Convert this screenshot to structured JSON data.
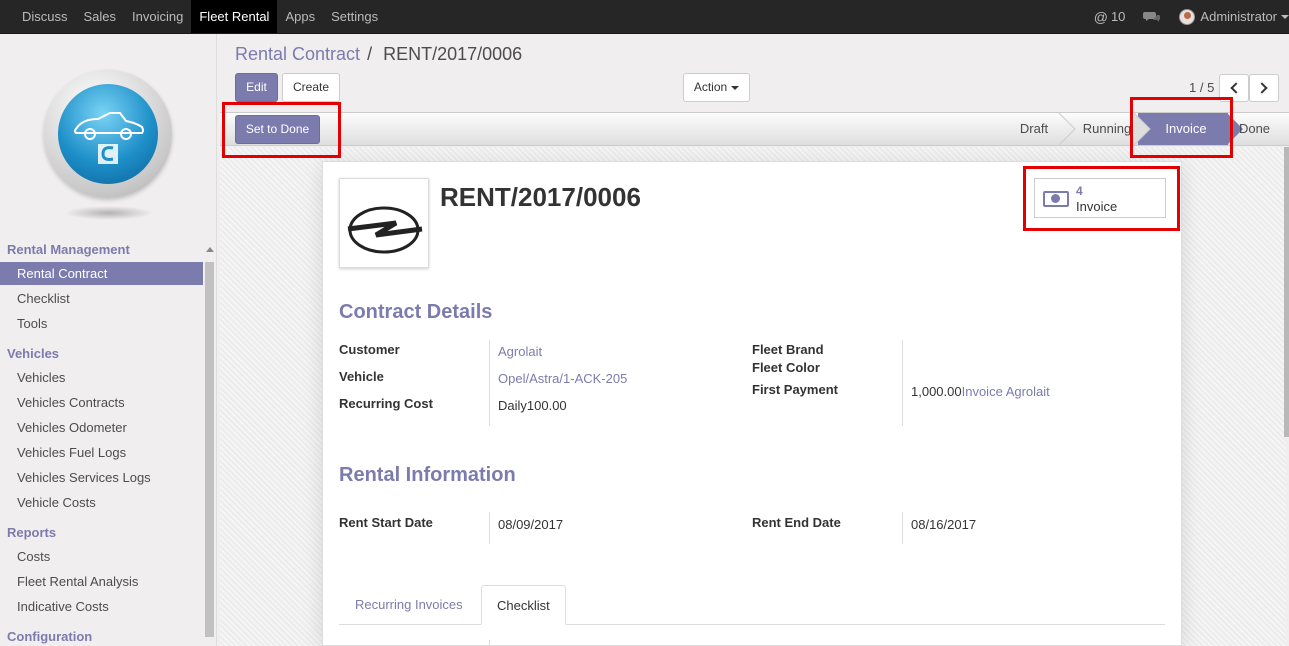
{
  "topbar": {
    "menu": [
      {
        "label": "Discuss",
        "active": false
      },
      {
        "label": "Sales",
        "active": false
      },
      {
        "label": "Invoicing",
        "active": false
      },
      {
        "label": "Fleet Rental",
        "active": true
      },
      {
        "label": "Apps",
        "active": false
      },
      {
        "label": "Settings",
        "active": false
      }
    ],
    "mentions_count": "10",
    "user_name": "Administrator"
  },
  "sidebar": {
    "sections": [
      {
        "title": "Rental Management",
        "items": [
          "Rental Contract",
          "Checklist",
          "Tools"
        ]
      },
      {
        "title": "Vehicles",
        "items": [
          "Vehicles",
          "Vehicles Contracts",
          "Vehicles Odometer",
          "Vehicles Fuel Logs",
          "Vehicles Services Logs",
          "Vehicle Costs"
        ]
      },
      {
        "title": "Reports",
        "items": [
          "Costs",
          "Fleet Rental Analysis",
          "Indicative Costs"
        ]
      },
      {
        "title": "Configuration",
        "items": []
      }
    ],
    "active_item": "Rental Contract"
  },
  "breadcrumb": {
    "parent": "Rental Contract",
    "separator": "/",
    "current": "RENT/2017/0006"
  },
  "buttons": {
    "edit": "Edit",
    "create": "Create",
    "action": "Action",
    "set_to_done": "Set to Done"
  },
  "pager": {
    "value": "1 / 5"
  },
  "status_stages": [
    "Draft",
    "Running",
    "Invoice",
    "Done"
  ],
  "active_stage": "Invoice",
  "record": {
    "title": "RENT/2017/0006",
    "smart_button": {
      "count": "4",
      "label": "Invoice"
    }
  },
  "contract_details": {
    "title": "Contract Details",
    "customer_label": "Customer",
    "customer_value": "Agrolait",
    "vehicle_label": "Vehicle",
    "vehicle_value": "Opel/Astra/1-ACK-205",
    "recurring_cost_label": "Recurring Cost",
    "recurring_cost_value": "Daily100.00",
    "fleet_brand_label": "Fleet Brand",
    "fleet_color_label": "Fleet Color",
    "first_payment_label": "First Payment",
    "first_payment_amount": "1,000.00",
    "first_payment_link": "Invoice Agrolait"
  },
  "rental_info": {
    "title": "Rental Information",
    "start_label": "Rent Start Date",
    "start_value": "08/09/2017",
    "end_label": "Rent End Date",
    "end_value": "08/16/2017"
  },
  "tabs": [
    "Recurring Invoices",
    "Checklist"
  ],
  "active_tab": "Checklist",
  "colors": {
    "accent": "#7c7bad",
    "highlight": "#e30000",
    "navbar": "#262626"
  }
}
